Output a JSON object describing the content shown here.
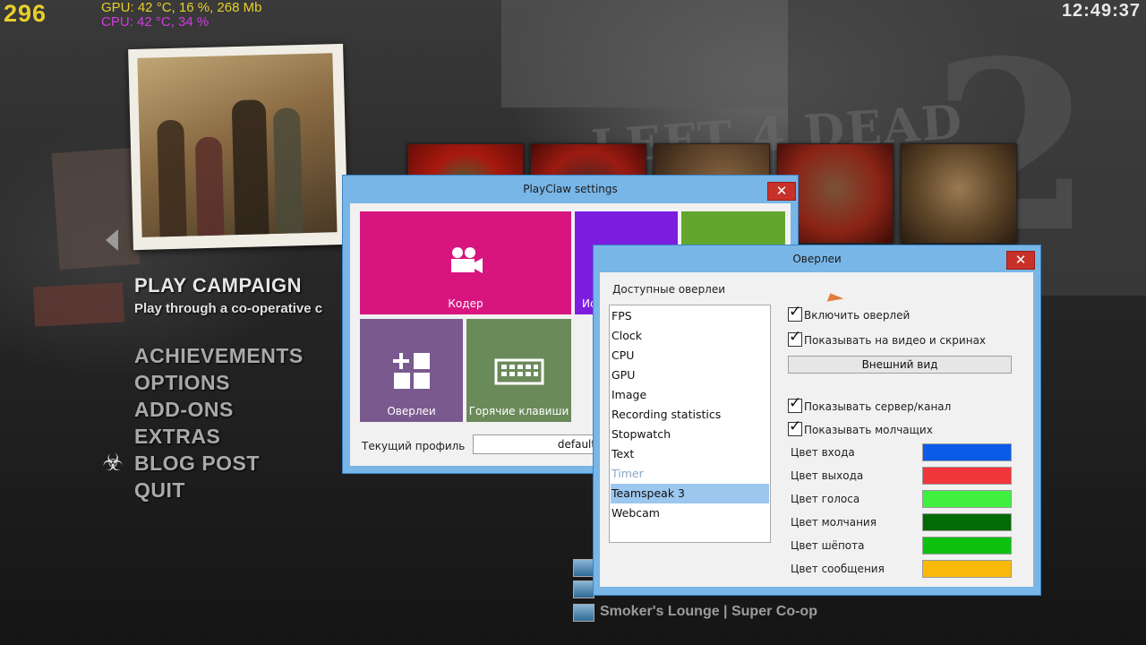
{
  "hud": {
    "fps": "296",
    "gpu": "GPU: 42 °C, 16 %, 268 Mb",
    "cpu": "CPU: 42 °C, 34 %",
    "clock": "12:49:37"
  },
  "game_menu": {
    "play_campaign": "PLAY CAMPAIGN",
    "play_campaign_sub": "Play through a co-operative c",
    "items": [
      "ACHIEVEMENTS",
      "OPTIONS",
      "ADD-ONS",
      "EXTRAS",
      "BLOG POST",
      "QUIT"
    ],
    "server_text": "Smoker's Lounge | Super Co-op"
  },
  "settings_window": {
    "title": "PlayClaw settings",
    "close": "✕",
    "tiles": {
      "coder": "Кодер",
      "purple_partial": "Ис",
      "overlays": "Оверлеи",
      "hotkeys": "Горячие клавиши"
    },
    "profile_label": "Текущий профиль",
    "profile_value": "default"
  },
  "overlay_window": {
    "title": "Оверлеи",
    "close": "✕",
    "available_label": "Доступные оверлеи",
    "list": [
      {
        "label": "FPS",
        "state": "normal"
      },
      {
        "label": "Clock",
        "state": "normal"
      },
      {
        "label": "CPU",
        "state": "normal"
      },
      {
        "label": "GPU",
        "state": "normal"
      },
      {
        "label": "Image",
        "state": "normal"
      },
      {
        "label": "Recording statistics",
        "state": "normal"
      },
      {
        "label": "Stopwatch",
        "state": "normal"
      },
      {
        "label": "Text",
        "state": "normal"
      },
      {
        "label": "Timer",
        "state": "disabled"
      },
      {
        "label": "Teamspeak 3",
        "state": "selected"
      },
      {
        "label": "Webcam",
        "state": "normal"
      }
    ],
    "checkboxes": {
      "enable_overlay": "Включить оверлей",
      "show_on_video": "Показывать на видео и скринах",
      "show_server": "Показывать сервер/канал",
      "show_silent": "Показывать молчащих"
    },
    "appearance_button": "Внешний вид",
    "colors": [
      {
        "label": "Цвет входа",
        "hex": "#0a5be8"
      },
      {
        "label": "Цвет выхода",
        "hex": "#f0353b"
      },
      {
        "label": "Цвет голоса",
        "hex": "#3ff03f"
      },
      {
        "label": "Цвет молчания",
        "hex": "#036b06"
      },
      {
        "label": "Цвет шёпота",
        "hex": "#0fc10f"
      },
      {
        "label": "Цвет сообщения",
        "hex": "#fbb90c"
      }
    ]
  }
}
